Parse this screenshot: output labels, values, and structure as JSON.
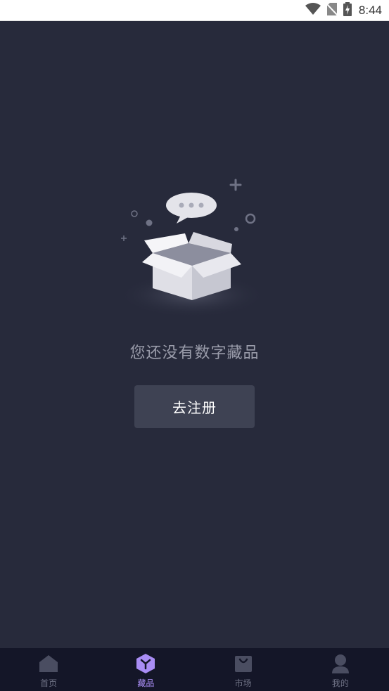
{
  "status_bar": {
    "time": "8:44",
    "icons": [
      "wifi-icon",
      "no-sim-icon",
      "battery-charging-icon"
    ]
  },
  "empty_state": {
    "message": "您还没有数字藏品",
    "button_label": "去注册",
    "illustration": "open-box-with-chat-bubble"
  },
  "tab_bar": {
    "active_index": 1,
    "active_color": "#a98df5",
    "inactive_color": "#4a4d61",
    "tabs": [
      {
        "label": "首页",
        "icon": "home-icon"
      },
      {
        "label": "藏品",
        "icon": "cube-icon"
      },
      {
        "label": "市场",
        "icon": "shopping-bag-icon"
      },
      {
        "label": "我的",
        "icon": "user-icon"
      }
    ]
  },
  "colors": {
    "background": "#272a3b",
    "button": "#3e4253",
    "tab_bar": "#141628"
  }
}
